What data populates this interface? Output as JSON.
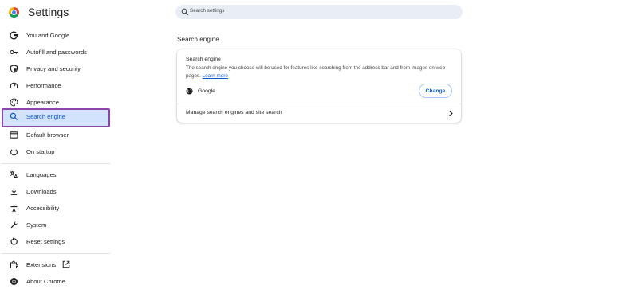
{
  "header": {
    "title": "Settings"
  },
  "search": {
    "placeholder": "Search settings",
    "icon": "search-icon"
  },
  "sidebar": {
    "items": [
      {
        "label": "You and Google",
        "icon": "google-g-icon"
      },
      {
        "label": "Autofill and passwords",
        "icon": "key-icon"
      },
      {
        "label": "Privacy and security",
        "icon": "shield-icon"
      },
      {
        "label": "Performance",
        "icon": "speedometer-icon"
      },
      {
        "label": "Appearance",
        "icon": "palette-icon"
      },
      {
        "label": "Search engine",
        "icon": "search-icon",
        "active": true
      },
      {
        "label": "Default browser",
        "icon": "browser-window-icon"
      },
      {
        "label": "On startup",
        "icon": "power-icon"
      },
      {
        "label": "Languages",
        "icon": "translate-icon"
      },
      {
        "label": "Downloads",
        "icon": "download-icon"
      },
      {
        "label": "Accessibility",
        "icon": "accessibility-icon"
      },
      {
        "label": "System",
        "icon": "wrench-icon"
      },
      {
        "label": "Reset settings",
        "icon": "reset-icon"
      },
      {
        "label": "Extensions",
        "icon": "puzzle-icon"
      },
      {
        "label": "About Chrome",
        "icon": "chrome-icon"
      }
    ]
  },
  "main": {
    "section_title": "Search engine",
    "card": {
      "label": "Search engine",
      "description": "The search engine you choose will be used for features like searching from the address bar and from images on web pages.",
      "learn_more": "Learn more",
      "engine_name": "Google",
      "change_label": "Change",
      "manage_label": "Manage search engines and site search"
    }
  },
  "colors": {
    "accent": "#0b57d0",
    "active_bg": "#d3e3fd",
    "highlight_border": "#8e44ad",
    "search_bg": "#e9eef6"
  }
}
